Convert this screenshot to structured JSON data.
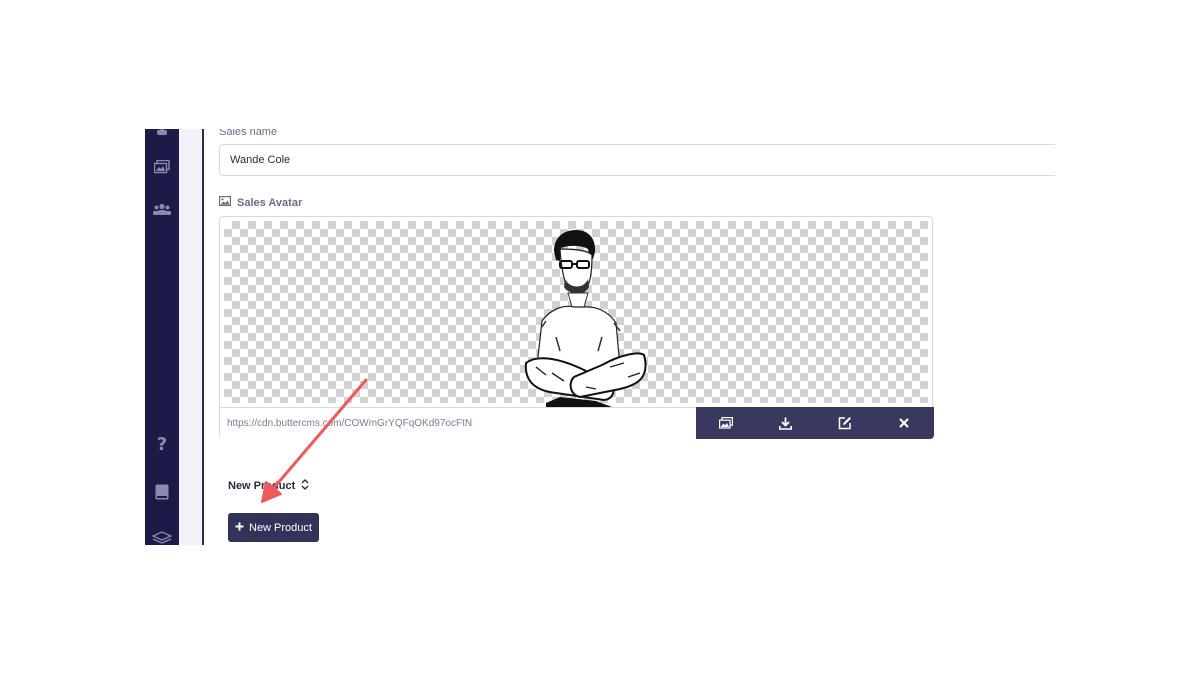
{
  "form": {
    "sales_name_label": "Sales name",
    "sales_name_value": "Wande Cole",
    "avatar_label": "Sales Avatar",
    "avatar_url": "https://cdn.buttercms.com/COWmGrYQFqOKd97ocFtN",
    "image_actions": [
      "image-library-icon",
      "download-icon",
      "edit-icon",
      "close-icon"
    ]
  },
  "collection": {
    "label": "New Product",
    "button_label": "New Product",
    "button_icon": "plus-icon"
  },
  "sidebar": {
    "icons": [
      "users-icon",
      "media-library-icon",
      "team-icon",
      "help-icon",
      "book-icon",
      "layers-icon"
    ]
  },
  "colors": {
    "sidebar": "#1c1a47",
    "action_bar": "#39395f",
    "button": "#33335a",
    "annotation_arrow": "#f0595c"
  }
}
